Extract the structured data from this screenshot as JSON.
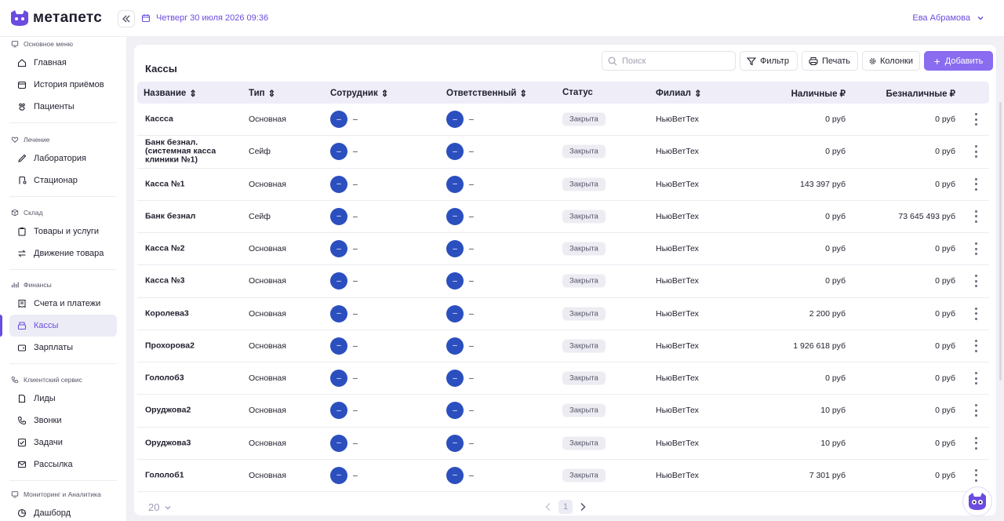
{
  "app": {
    "brand": "метапетс",
    "datetime": "Четверг 30 июля 2026 09:36",
    "user_name": "Ева Абрамова",
    "accent": "#6c4be0"
  },
  "sidebar": {
    "sections": [
      {
        "title": "Основное меню",
        "icon": "monitor-icon",
        "items": [
          {
            "label": "Главная",
            "icon": "home-icon"
          },
          {
            "label": "История приёмов",
            "icon": "calendar-icon"
          },
          {
            "label": "Пациенты",
            "icon": "paw-icon"
          }
        ]
      },
      {
        "title": "Лечение",
        "icon": "heart-icon",
        "items": [
          {
            "label": "Лаборатория",
            "icon": "pipette-icon"
          },
          {
            "label": "Стационар",
            "icon": "drip-icon"
          }
        ]
      },
      {
        "title": "Склад",
        "icon": "box-icon",
        "items": [
          {
            "label": "Товары и услуги",
            "icon": "clipboard-icon"
          },
          {
            "label": "Движение товара",
            "icon": "arrows-icon"
          }
        ]
      },
      {
        "title": "Финансы",
        "icon": "chart-icon",
        "items": [
          {
            "label": "Счета и платежи",
            "icon": "receipt-icon"
          },
          {
            "label": "Кассы",
            "icon": "register-icon",
            "active": true
          },
          {
            "label": "Зарплаты",
            "icon": "wallet-icon"
          }
        ]
      },
      {
        "title": "Клиентский сервис",
        "icon": "phone-icon",
        "items": [
          {
            "label": "Лиды",
            "icon": "doc-icon"
          },
          {
            "label": "Звонки",
            "icon": "phone-icon"
          },
          {
            "label": "Задачи",
            "icon": "tasks-icon"
          },
          {
            "label": "Рассылка",
            "icon": "mail-icon"
          }
        ]
      },
      {
        "title": "Мониторинг и Аналитика",
        "icon": "monitor-icon",
        "items": [
          {
            "label": "Дашборд",
            "icon": "pie-icon"
          }
        ]
      }
    ]
  },
  "toolbar": {
    "title": "Кассы",
    "search_placeholder": "Поиск",
    "filter_label": "Фильтр",
    "print_label": "Печать",
    "columns_label": "Колонки",
    "add_label": "Добавить"
  },
  "table": {
    "columns": {
      "name": "Название",
      "type": "Тип",
      "employee": "Сотрудник",
      "responsible": "Ответственный",
      "status": "Статус",
      "branch": "Филиал",
      "cash": "Наличные ₽",
      "cashless": "Безналичные ₽"
    },
    "avatar_label": "–",
    "empty_value": "–",
    "rows": [
      {
        "name": "Кассса",
        "type": "Основная",
        "status": "Закрыта",
        "branch": "НьюВетТех",
        "cash": "0 руб",
        "cashless": "0 руб"
      },
      {
        "name": "Банк безнал. (системная касса клиники №1)",
        "type": "Сейф",
        "status": "Закрыта",
        "branch": "НьюВетТех",
        "cash": "0 руб",
        "cashless": "0 руб"
      },
      {
        "name": "Касса №1",
        "type": "Основная",
        "status": "Закрыта",
        "branch": "НьюВетТех",
        "cash": "143 397 руб",
        "cashless": "0 руб"
      },
      {
        "name": "Банк безнал",
        "type": "Сейф",
        "status": "Закрыта",
        "branch": "НьюВетТех",
        "cash": "0 руб",
        "cashless": "73 645 493 руб"
      },
      {
        "name": "Касса №2",
        "type": "Основная",
        "status": "Закрыта",
        "branch": "НьюВетТех",
        "cash": "0 руб",
        "cashless": "0 руб"
      },
      {
        "name": "Касса №3",
        "type": "Основная",
        "status": "Закрыта",
        "branch": "НьюВетТех",
        "cash": "0 руб",
        "cashless": "0 руб"
      },
      {
        "name": "Королева3",
        "type": "Основная",
        "status": "Закрыта",
        "branch": "НьюВетТех",
        "cash": "2 200 руб",
        "cashless": "0 руб"
      },
      {
        "name": "Прохорова2",
        "type": "Основная",
        "status": "Закрыта",
        "branch": "НьюВетТех",
        "cash": "1 926 618 руб",
        "cashless": "0 руб"
      },
      {
        "name": "Гололоб3",
        "type": "Основная",
        "status": "Закрыта",
        "branch": "НьюВетТех",
        "cash": "0 руб",
        "cashless": "0 руб"
      },
      {
        "name": "Оруджова2",
        "type": "Основная",
        "status": "Закрыта",
        "branch": "НьюВетТех",
        "cash": "10 руб",
        "cashless": "0 руб"
      },
      {
        "name": "Оруджова3",
        "type": "Основная",
        "status": "Закрыта",
        "branch": "НьюВетТех",
        "cash": "10 руб",
        "cashless": "0 руб"
      },
      {
        "name": "Гололоб1",
        "type": "Основная",
        "status": "Закрыта",
        "branch": "НьюВетТех",
        "cash": "7 301 руб",
        "cashless": "0 руб"
      }
    ]
  },
  "footer": {
    "page_size": "20",
    "current_page": "1"
  }
}
